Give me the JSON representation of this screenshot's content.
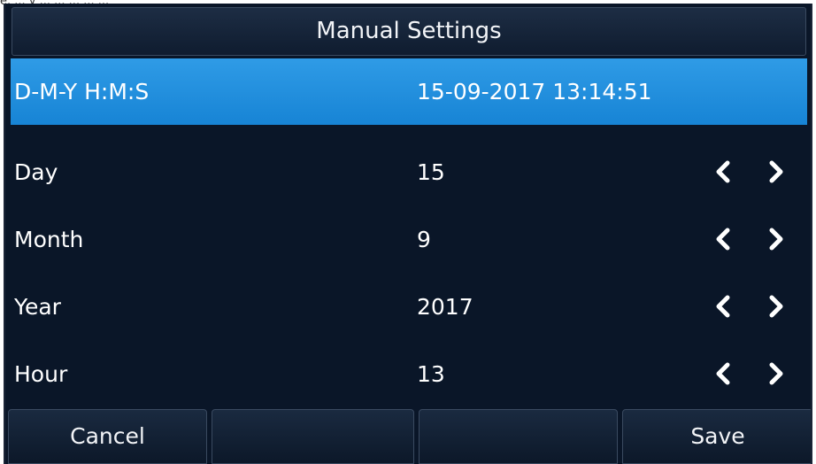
{
  "top_fragment": "e. ... y ... ... ... ... ...",
  "title": "Manual Settings",
  "summary": {
    "label": "D-M-Y H:M:S",
    "value": "15-09-2017 13:14:51"
  },
  "fields": [
    {
      "label": "Day",
      "value": "15"
    },
    {
      "label": "Month",
      "value": "9"
    },
    {
      "label": "Year",
      "value": "2017"
    },
    {
      "label": "Hour",
      "value": "13"
    }
  ],
  "softkeys": [
    "Cancel",
    "",
    "",
    "Save"
  ],
  "colors": {
    "background": "#0a1628",
    "selected_row": "#1f8fdf",
    "text": "#ffffff"
  },
  "icons": {
    "decrement": "chevron-left-icon",
    "increment": "chevron-right-icon"
  }
}
